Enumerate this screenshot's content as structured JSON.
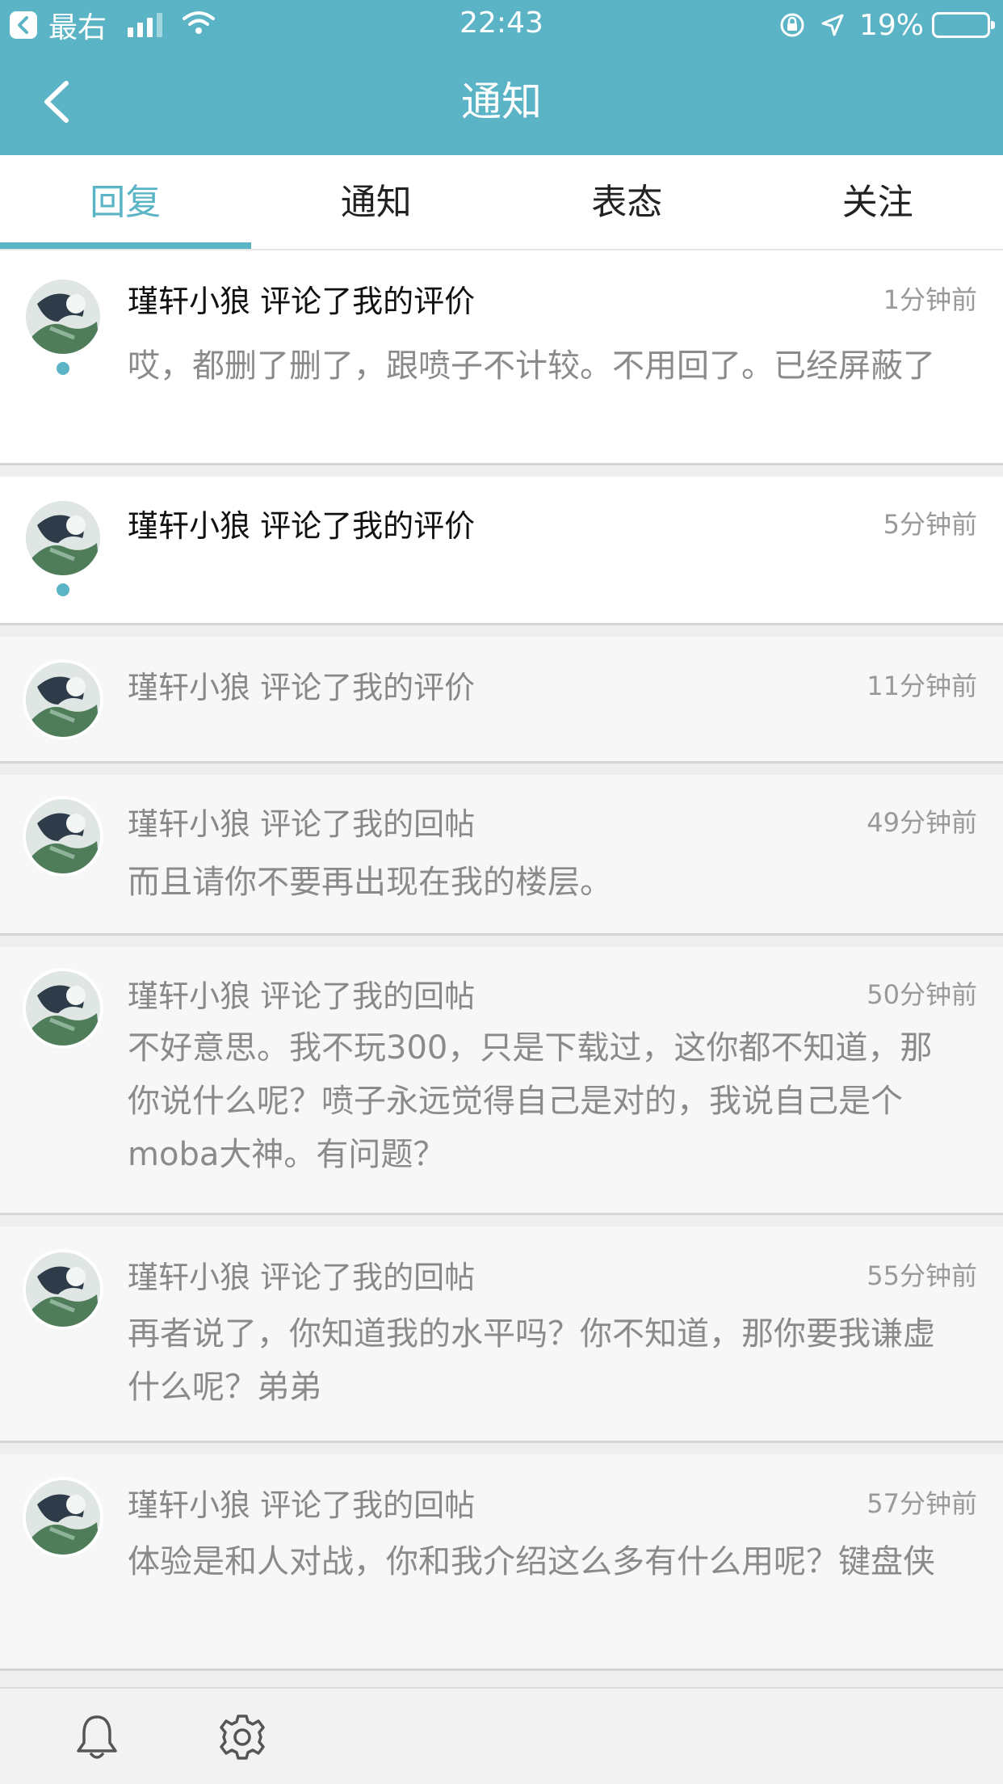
{
  "status_bar": {
    "back_app_label": "最右",
    "time": "22:43",
    "battery": "19%",
    "battery_level": 0.19,
    "battery_color": "#ff3b30"
  },
  "header": {
    "title": "通知",
    "back_icon": "chevron-left-icon",
    "bg_color": "#5ab4c5"
  },
  "tabs": [
    {
      "label": "回复",
      "active": true
    },
    {
      "label": "通知",
      "active": false
    },
    {
      "label": "表态",
      "active": false
    },
    {
      "label": "关注",
      "active": false
    }
  ],
  "notifications": [
    {
      "title": "瑾轩小狼 评论了我的评价",
      "time": "1分钟前",
      "content": "哎，都删了删了，跟喷子不计较。不用回了。已经屏蔽了",
      "unread": true
    },
    {
      "title": "瑾轩小狼 评论了我的评价",
      "time": "5分钟前",
      "content": "",
      "unread": true
    },
    {
      "title": "瑾轩小狼 评论了我的评价",
      "time": "11分钟前",
      "content": "",
      "unread": false
    },
    {
      "title": "瑾轩小狼 评论了我的回帖",
      "time": "49分钟前",
      "content": "而且请你不要再出现在我的楼层。",
      "unread": false
    },
    {
      "title": "瑾轩小狼 评论了我的回帖",
      "time": "50分钟前",
      "content": "不好意思。我不玩300，只是下载过，这你都不知道，那你说什么呢？喷子永远觉得自己是对的，我说自己是个moba大神。有问题？",
      "unread": false
    },
    {
      "title": "瑾轩小狼 评论了我的回帖",
      "time": "55分钟前",
      "content": "再者说了，你知道我的水平吗？你不知道，那你要我谦虚什么呢？弟弟",
      "unread": false
    },
    {
      "title": "瑾轩小狼 评论了我的回帖",
      "time": "57分钟前",
      "content": "体验是和人对战，你和我介绍这么多有什么用呢？键盘侠",
      "unread": false
    }
  ],
  "bottom_bar": {
    "icons": [
      "bell-icon",
      "gear-icon"
    ]
  },
  "colors": {
    "accent": "#5ab4c5",
    "unread_dot": "#5ab4c5"
  }
}
